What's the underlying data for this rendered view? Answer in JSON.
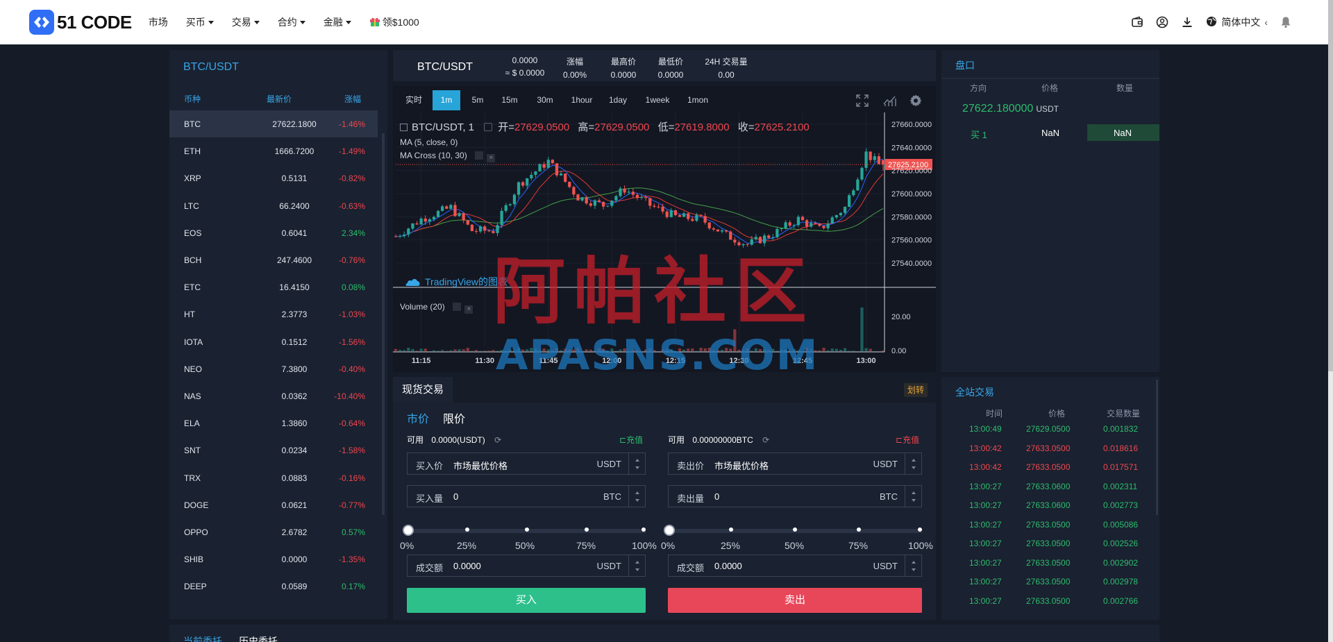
{
  "header": {
    "logo_text": "51 CODE",
    "nav": [
      {
        "label": "市场",
        "dropdown": false
      },
      {
        "label": "买币",
        "dropdown": true
      },
      {
        "label": "交易",
        "dropdown": true
      },
      {
        "label": "合约",
        "dropdown": true
      },
      {
        "label": "金融",
        "dropdown": true
      }
    ],
    "promo": "领$1000",
    "language": "简体中文",
    "lang_arrow": "‹",
    "icons": [
      "wallet-icon",
      "user-icon",
      "download-icon",
      "globe-icon",
      "bell-icon"
    ]
  },
  "markets": {
    "title": "BTC/USDT",
    "columns": [
      "币种",
      "最新价",
      "涨幅"
    ],
    "rows": [
      {
        "symbol": "BTC",
        "price": "27622.1800",
        "change": "-1.46%",
        "dir": "neg"
      },
      {
        "symbol": "ETH",
        "price": "1666.7200",
        "change": "-1.49%",
        "dir": "neg"
      },
      {
        "symbol": "XRP",
        "price": "0.5131",
        "change": "-0.82%",
        "dir": "neg"
      },
      {
        "symbol": "LTC",
        "price": "66.2400",
        "change": "-0.63%",
        "dir": "neg"
      },
      {
        "symbol": "EOS",
        "price": "0.6041",
        "change": "2.34%",
        "dir": "pos"
      },
      {
        "symbol": "BCH",
        "price": "247.4600",
        "change": "-0.76%",
        "dir": "neg"
      },
      {
        "symbol": "ETC",
        "price": "16.4150",
        "change": "0.08%",
        "dir": "pos"
      },
      {
        "symbol": "HT",
        "price": "2.3773",
        "change": "-1.03%",
        "dir": "neg"
      },
      {
        "symbol": "IOTA",
        "price": "0.1512",
        "change": "-1.56%",
        "dir": "neg"
      },
      {
        "symbol": "NEO",
        "price": "7.3800",
        "change": "-0.40%",
        "dir": "neg"
      },
      {
        "symbol": "NAS",
        "price": "0.0362",
        "change": "-10.40%",
        "dir": "neg"
      },
      {
        "symbol": "ELA",
        "price": "1.3860",
        "change": "-0.64%",
        "dir": "neg"
      },
      {
        "symbol": "SNT",
        "price": "0.0234",
        "change": "-1.58%",
        "dir": "neg"
      },
      {
        "symbol": "TRX",
        "price": "0.0883",
        "change": "-0.16%",
        "dir": "neg"
      },
      {
        "symbol": "DOGE",
        "price": "0.0621",
        "change": "-0.77%",
        "dir": "neg"
      },
      {
        "symbol": "OPPO",
        "price": "2.6782",
        "change": "0.57%",
        "dir": "pos"
      },
      {
        "symbol": "SHIB",
        "price": "0.0000",
        "change": "-1.35%",
        "dir": "neg"
      },
      {
        "symbol": "DEEP",
        "price": "0.0589",
        "change": "0.17%",
        "dir": "pos"
      }
    ]
  },
  "ticker": {
    "symbol": "BTC/USDT",
    "price": "0.0000",
    "price_usd": "≈ $ 0.0000",
    "change_label": "涨幅",
    "change_value": "0.00%",
    "high_label": "最高价",
    "high_value": "0.0000",
    "low_label": "最低价",
    "low_value": "0.0000",
    "vol_label": "24H 交易量",
    "vol_value": "0.00"
  },
  "chart": {
    "timeframes": [
      "实时",
      "1m",
      "5m",
      "15m",
      "30m",
      "1hour",
      "1day",
      "1week",
      "1mon"
    ],
    "active_timeframe": "1m",
    "legend_symbol": "BTC/USDT, 1",
    "open_label": "开=",
    "open": "27629.0500",
    "high_label": "高=",
    "high": "27629.0500",
    "low_label": "低=",
    "low": "27619.8000",
    "close_label": "收=",
    "close": "27625.2100",
    "study_ma": "MA (5, close, 0)",
    "study_cross": "MA Cross (10, 30)",
    "study_volume": "Volume (20)",
    "brand": "TradingView的图表",
    "price_ticks": [
      "27660.0000",
      "27640.0000",
      "27620.0000",
      "27600.0000",
      "27580.0000",
      "27560.0000",
      "27540.0000"
    ],
    "volume_ticks": [
      "20.00",
      "0.00"
    ],
    "time_ticks": [
      "11:15",
      "11:30",
      "11:45",
      "12:00",
      "12:15",
      "12:30",
      "12:45",
      "13:00"
    ],
    "last_price_label": "27625.2100",
    "colors": {
      "up": "#26a69a",
      "down": "#ef5350",
      "ma": "#2962ff",
      "ma_cross_fast": "#e53935",
      "ma_cross_slow": "#43a047"
    }
  },
  "chart_data": {
    "type": "candlestick",
    "title": "BTC/USDT, 1",
    "x_interval": "1m",
    "x_range": [
      "11:09",
      "13:04"
    ],
    "ylim": [
      27530,
      27670
    ],
    "last_close": 27625.21,
    "ohlc_last": {
      "open": 27629.05,
      "high": 27629.05,
      "low": 27619.8,
      "close": 27625.21
    },
    "close_path": [
      {
        "t": "11:09",
        "close": 27563
      },
      {
        "t": "11:15",
        "close": 27578
      },
      {
        "t": "11:22",
        "close": 27588
      },
      {
        "t": "11:27",
        "close": 27568
      },
      {
        "t": "11:32",
        "close": 27568
      },
      {
        "t": "11:38",
        "close": 27608
      },
      {
        "t": "11:45",
        "close": 27628
      },
      {
        "t": "11:52",
        "close": 27597
      },
      {
        "t": "11:58",
        "close": 27590
      },
      {
        "t": "12:03",
        "close": 27604
      },
      {
        "t": "12:09",
        "close": 27590
      },
      {
        "t": "12:15",
        "close": 27580
      },
      {
        "t": "12:21",
        "close": 27578
      },
      {
        "t": "12:27",
        "close": 27564
      },
      {
        "t": "12:32",
        "close": 27556
      },
      {
        "t": "12:38",
        "close": 27565
      },
      {
        "t": "12:44",
        "close": 27578
      },
      {
        "t": "12:49",
        "close": 27569
      },
      {
        "t": "12:55",
        "close": 27588
      },
      {
        "t": "13:00",
        "close": 27635
      },
      {
        "t": "13:03",
        "close": 27625
      }
    ],
    "volume_ylim": [
      0,
      30
    ],
    "volume_spikes": [
      {
        "t": "12:29",
        "volume": 15
      },
      {
        "t": "12:59",
        "volume": 30
      }
    ]
  },
  "orderbook": {
    "title": "盘口",
    "columns": [
      "方向",
      "价格",
      "数量"
    ],
    "last_price": "27622.180000",
    "last_unit": "USDT",
    "rows": [
      {
        "side": "买 1",
        "price": "NaN",
        "amount": "NaN"
      }
    ]
  },
  "trade": {
    "tab": "现货交易",
    "transfer": "划转",
    "order_types": [
      "市价",
      "限价"
    ],
    "buy": {
      "avail_label": "可用",
      "avail_value": "0.0000(USDT)",
      "deposit": "充值",
      "price_label": "买入价",
      "price_value": "市场最优价格",
      "price_unit": "USDT",
      "amount_label": "买入量",
      "amount_value": "0",
      "amount_unit": "BTC",
      "total_label": "成交额",
      "total_value": "0.0000",
      "total_unit": "USDT",
      "button": "买入"
    },
    "sell": {
      "avail_label": "可用",
      "avail_value": "0.00000000BTC",
      "deposit": "充值",
      "price_label": "卖出价",
      "price_value": "市场最优价格",
      "price_unit": "USDT",
      "amount_label": "卖出量",
      "amount_value": "0",
      "amount_unit": "BTC",
      "total_label": "成交额",
      "total_value": "0.0000",
      "total_unit": "USDT",
      "button": "卖出"
    },
    "slider_labels": [
      "0%",
      "25%",
      "50%",
      "75%",
      "100%"
    ],
    "slider_value_buy": 0,
    "slider_value_sell": 0
  },
  "market_trades": {
    "title": "全站交易",
    "columns": [
      "时间",
      "价格",
      "交易数量"
    ],
    "rows": [
      {
        "time": "13:00:49",
        "price": "27629.0500",
        "amount": "0.001832",
        "dir": "pos"
      },
      {
        "time": "13:00:42",
        "price": "27633.0500",
        "amount": "0.018616",
        "dir": "neg"
      },
      {
        "time": "13:00:42",
        "price": "27633.0500",
        "amount": "0.017571",
        "dir": "neg"
      },
      {
        "time": "13:00:27",
        "price": "27633.0600",
        "amount": "0.002311",
        "dir": "pos"
      },
      {
        "time": "13:00:27",
        "price": "27633.0600",
        "amount": "0.002773",
        "dir": "pos"
      },
      {
        "time": "13:00:27",
        "price": "27633.0500",
        "amount": "0.005086",
        "dir": "pos"
      },
      {
        "time": "13:00:27",
        "price": "27633.0500",
        "amount": "0.002526",
        "dir": "pos"
      },
      {
        "time": "13:00:27",
        "price": "27633.0500",
        "amount": "0.002902",
        "dir": "pos"
      },
      {
        "time": "13:00:27",
        "price": "27633.0500",
        "amount": "0.002978",
        "dir": "pos"
      },
      {
        "time": "13:00:27",
        "price": "27633.0500",
        "amount": "0.002766",
        "dir": "pos"
      }
    ]
  },
  "bottom_tabs": [
    "当前委托",
    "历史委托"
  ],
  "watermark": {
    "cn": "阿帕社区",
    "en": "APASNS.COM"
  }
}
